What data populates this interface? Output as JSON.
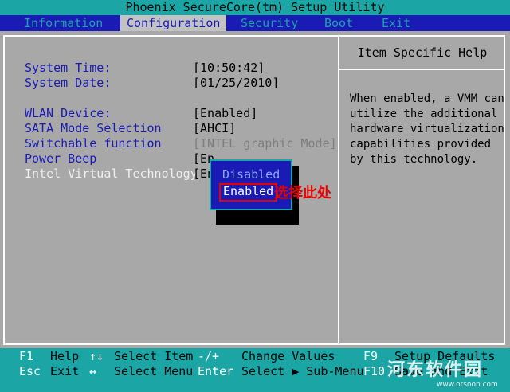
{
  "title": "Phoenix SecureCore(tm) Setup Utility",
  "menu": [
    {
      "label": "Information",
      "active": false
    },
    {
      "label": "Configuration",
      "active": true
    },
    {
      "label": "Security",
      "active": false
    },
    {
      "label": "Boot",
      "active": false
    },
    {
      "label": "Exit",
      "active": false
    }
  ],
  "settings": [
    {
      "label": "System Time:",
      "value": "[10:50:42]"
    },
    {
      "label": "System Date:",
      "value": "[01/25/2010]"
    },
    {
      "label": "WLAN Device:",
      "value": "[Enabled]"
    },
    {
      "label": "SATA Mode Selection",
      "value": "[AHCI]"
    },
    {
      "label": "Switchable function",
      "value": "[INTEL graphic Mode]"
    },
    {
      "label": "Power Beep",
      "value": "[En"
    },
    {
      "label": "Intel Virtual Technology",
      "value": "[En"
    }
  ],
  "help": {
    "title": "Item Specific Help",
    "lines": [
      "When enabled, a VMM can",
      "utilize the additional",
      "hardware virtualization",
      "capabilities provided",
      "by this technology."
    ]
  },
  "popup": {
    "options": [
      "Disabled",
      "Enabled"
    ],
    "selected": "Enabled"
  },
  "annotation": "选择此处",
  "footer": {
    "row1": [
      {
        "key": "F1",
        "desc": "Help"
      },
      {
        "key": "↑↓",
        "desc": "Select Item"
      },
      {
        "key": "-/+",
        "desc": "Change Values"
      },
      {
        "key": "F9",
        "desc": "Setup Defaults"
      }
    ],
    "row2": [
      {
        "key": "Esc",
        "desc": "Exit"
      },
      {
        "key": "↔",
        "desc": "Select Menu"
      },
      {
        "key": "Enter",
        "desc": "Select ▶ Sub-Menu"
      },
      {
        "key": "F10",
        "desc": "Save and Exit"
      }
    ]
  },
  "watermark": {
    "text": "河东软件园",
    "url": "www.orsoon.com"
  },
  "colors": {
    "teal": "#1ba5a5",
    "blue": "#1a1ab5",
    "gray": "#a8a8a8",
    "red": "#e60000"
  }
}
